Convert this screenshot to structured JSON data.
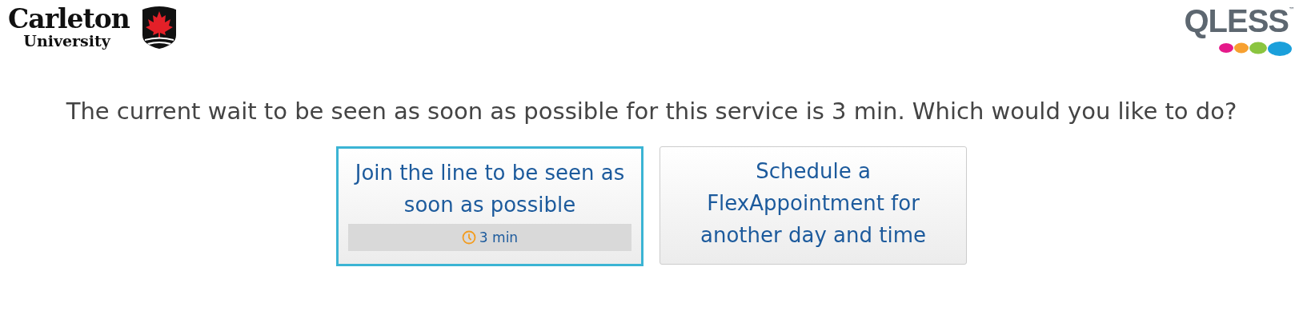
{
  "header": {
    "university_logo": {
      "name": "Carleton",
      "subtitle": "University"
    },
    "qless_logo": {
      "name": "QLESS",
      "trademark": "™"
    }
  },
  "message": "The current wait to be seen as soon as possible for this service is 3 min. Which would you like to do?",
  "options": [
    {
      "label": "Join the line to be seen as soon as possible",
      "selected": true,
      "wait": "3 min"
    },
    {
      "label": "Schedule a FlexAppointment for another day and time",
      "selected": false
    }
  ]
}
